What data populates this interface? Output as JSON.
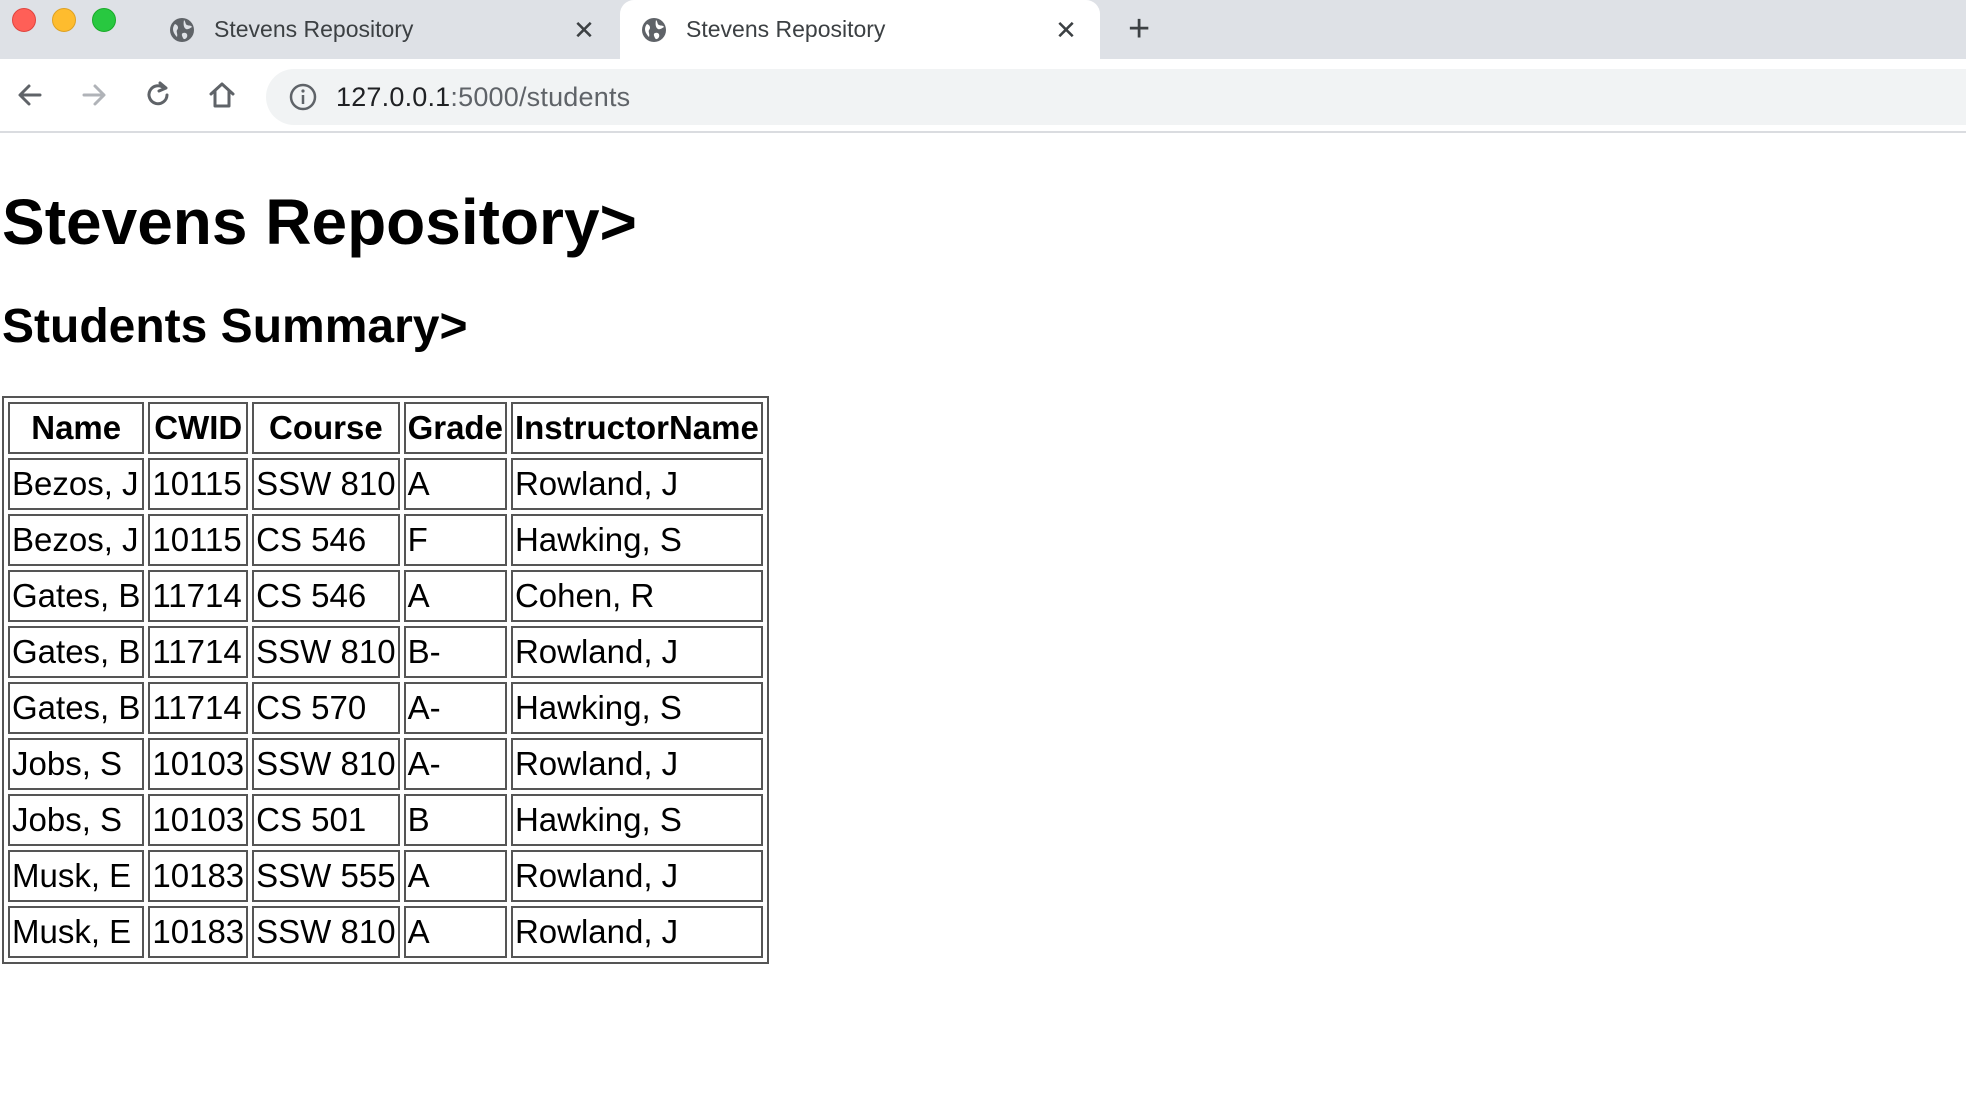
{
  "browser": {
    "tabs": [
      {
        "title": "Stevens Repository",
        "active": false
      },
      {
        "title": "Stevens Repository",
        "active": true
      }
    ],
    "address": {
      "host": "127.0.0.1",
      "rest": ":5000/students"
    }
  },
  "page": {
    "heading": "Stevens Repository>",
    "subheading": "Students Summary>"
  },
  "table": {
    "columns": [
      "Name",
      "CWID",
      "Course",
      "Grade",
      "InstructorName"
    ],
    "rows": [
      [
        "Bezos, J",
        "10115",
        "SSW 810",
        "A",
        "Rowland, J"
      ],
      [
        "Bezos, J",
        "10115",
        "CS 546",
        "F",
        "Hawking, S"
      ],
      [
        "Gates, B",
        "11714",
        "CS 546",
        "A",
        "Cohen, R"
      ],
      [
        "Gates, B",
        "11714",
        "SSW 810",
        "B-",
        "Rowland, J"
      ],
      [
        "Gates, B",
        "11714",
        "CS 570",
        "A-",
        "Hawking, S"
      ],
      [
        "Jobs, S",
        "10103",
        "SSW 810",
        "A-",
        "Rowland, J"
      ],
      [
        "Jobs, S",
        "10103",
        "CS 501",
        "B",
        "Hawking, S"
      ],
      [
        "Musk, E",
        "10183",
        "SSW 555",
        "A",
        "Rowland, J"
      ],
      [
        "Musk, E",
        "10183",
        "SSW 810",
        "A",
        "Rowland, J"
      ]
    ]
  }
}
